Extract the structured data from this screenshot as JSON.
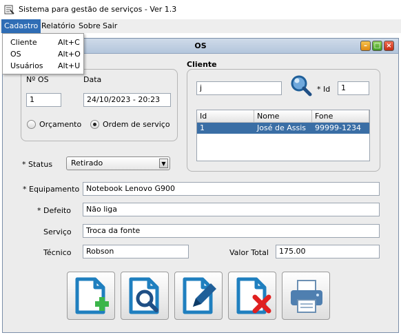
{
  "window": {
    "title": "Sistema para gestão de serviços - Ver 1.3"
  },
  "menubar": [
    "Cadastro",
    "Relatório",
    "Sobre",
    "Sair"
  ],
  "cadastro_menu": [
    {
      "label": "Cliente",
      "shortcut": "Alt+C"
    },
    {
      "label": "OS",
      "shortcut": "Alt+O"
    },
    {
      "label": "Usuários",
      "shortcut": "Alt+U"
    }
  ],
  "frame": {
    "title": "OS"
  },
  "os_group": {
    "number_label": "Nº OS",
    "number_value": "1",
    "date_label": "Data",
    "date_value": "24/10/2023 - 20:23",
    "radio_orcamento": "Orçamento",
    "radio_ordem": "Ordem de serviço",
    "selected_type": "Ordem de serviço"
  },
  "cliente": {
    "title": "Cliente",
    "search_value": "j",
    "id_label": "* Id",
    "id_value": "1",
    "table_headers": [
      "Id",
      "Nome",
      "Fone"
    ],
    "rows": [
      {
        "id": "1",
        "nome": "José de Assis",
        "fone": "99999-1234",
        "selected": true
      }
    ]
  },
  "form": {
    "status_label": "* Status",
    "status_value": "Retirado",
    "equipamento_label": "* Equipamento",
    "equipamento_value": "Notebook Lenovo G900",
    "defeito_label": "* Defeito",
    "defeito_value": "Não liga",
    "servico_label": "Serviço",
    "servico_value": "Troca da fonte",
    "tecnico_label": "Técnico",
    "tecnico_value": "Robson",
    "valor_label": "Valor Total",
    "valor_value": "175.00"
  },
  "actions": [
    "add-icon",
    "search-icon",
    "edit-icon",
    "delete-icon",
    "print-icon"
  ],
  "colors": {
    "accent": "#2f6db5",
    "selection": "#3a6ea5",
    "add": "#3bb54a",
    "delete": "#e02020",
    "doc": "#1f7fbf"
  }
}
